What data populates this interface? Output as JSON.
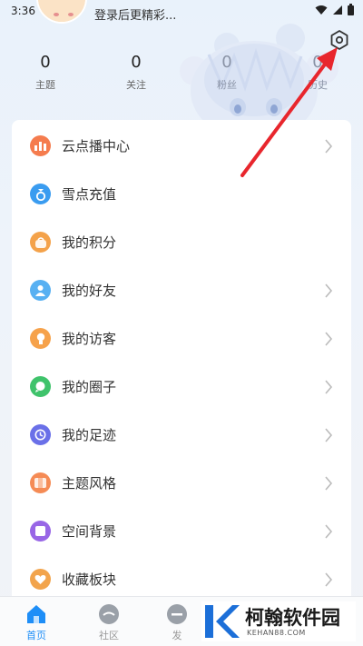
{
  "status_bar": {
    "time": "3:36"
  },
  "header": {
    "login_prompt": "登录后更精彩..."
  },
  "stats": [
    {
      "value": "0",
      "label": "主题"
    },
    {
      "value": "0",
      "label": "关注"
    },
    {
      "value": "0",
      "label": "粉丝"
    },
    {
      "value": "0",
      "label": "历史"
    }
  ],
  "menu": [
    {
      "label": "云点播中心",
      "icon": "bar-chart-icon",
      "color": "#f57c4e"
    },
    {
      "label": "雪点充值",
      "icon": "diamond-icon",
      "color": "#3a9cf0"
    },
    {
      "label": "我的积分",
      "icon": "bag-icon",
      "color": "#f4a24a"
    },
    {
      "label": "我的好友",
      "icon": "user-icon",
      "color": "#57b0f2"
    },
    {
      "label": "我的访客",
      "icon": "lightbulb-icon",
      "color": "#f6a24b"
    },
    {
      "label": "我的圈子",
      "icon": "chat-bubble-icon",
      "color": "#3fc36b"
    },
    {
      "label": "我的足迹",
      "icon": "clock-icon",
      "color": "#6a70e8"
    },
    {
      "label": "主题风格",
      "icon": "palette-icon",
      "color": "#f58b55"
    },
    {
      "label": "空间背景",
      "icon": "square-icon",
      "color": "#9866e6"
    },
    {
      "label": "收藏板块",
      "icon": "heart-icon",
      "color": "#f2a44c"
    }
  ],
  "bottom_nav": [
    {
      "label": "首页",
      "icon": "home-icon"
    },
    {
      "label": "社区",
      "icon": "community-icon"
    },
    {
      "label": "发",
      "icon": "publish-icon"
    }
  ],
  "watermark": {
    "title": "柯翰软件园",
    "domain": "KEHAN88.COM"
  },
  "colors": {
    "accent": "#1e8ef7",
    "annotation": "#e8262d"
  }
}
